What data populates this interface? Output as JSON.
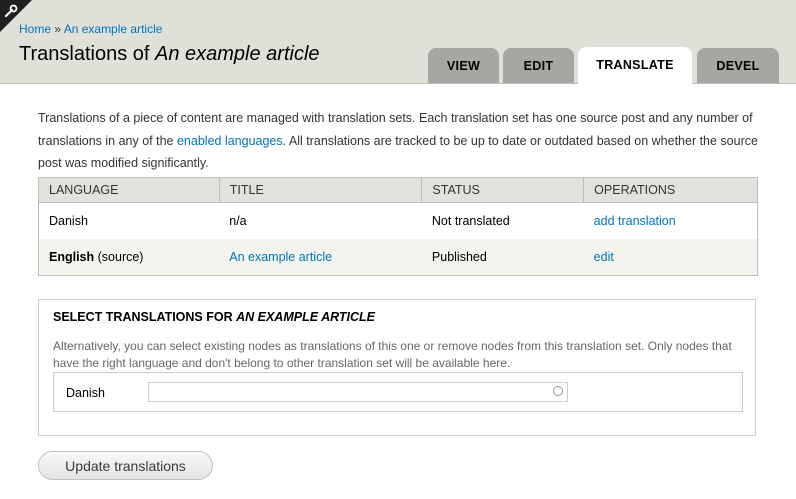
{
  "breadcrumb": {
    "home": "Home",
    "separator": " » ",
    "current": "An example article"
  },
  "page_title": {
    "prefix": "Translations of ",
    "node": "An example article"
  },
  "tabs": [
    {
      "label": "View",
      "active": false
    },
    {
      "label": "Edit",
      "active": false
    },
    {
      "label": "Translate",
      "active": true
    },
    {
      "label": "Devel",
      "active": false
    }
  ],
  "intro": {
    "before_link": "Translations of a piece of content are managed with translation sets. Each translation set has one source post and any number of translations in any of the ",
    "link": "enabled languages",
    "after_link": ". All translations are tracked to be up to date or outdated based on whether the source post was modified significantly."
  },
  "table": {
    "headers": [
      "Language",
      "Title",
      "Status",
      "Operations"
    ],
    "rows": [
      {
        "language": "Danish",
        "language_suffix": "",
        "title": "n/a",
        "title_link": false,
        "status": "Not translated",
        "operation": "add translation"
      },
      {
        "language": "English",
        "language_suffix": " (source)",
        "title": "An example article",
        "title_link": true,
        "status": "Published",
        "operation": "edit"
      }
    ]
  },
  "fieldset": {
    "legend_prefix": "Select translations for ",
    "legend_node": "An example article",
    "description": "Alternatively, you can select existing nodes as translations of this one or remove nodes from this translation set. Only nodes that have the right language and don't belong to other translation set will be available here.",
    "row_label": "Danish",
    "input_value": "",
    "input_placeholder": ""
  },
  "submit_label": "Update translations",
  "colors": {
    "header_bg": "#e0e0d8",
    "tab_bg": "#a6a7a2",
    "link": "#0074bd"
  }
}
